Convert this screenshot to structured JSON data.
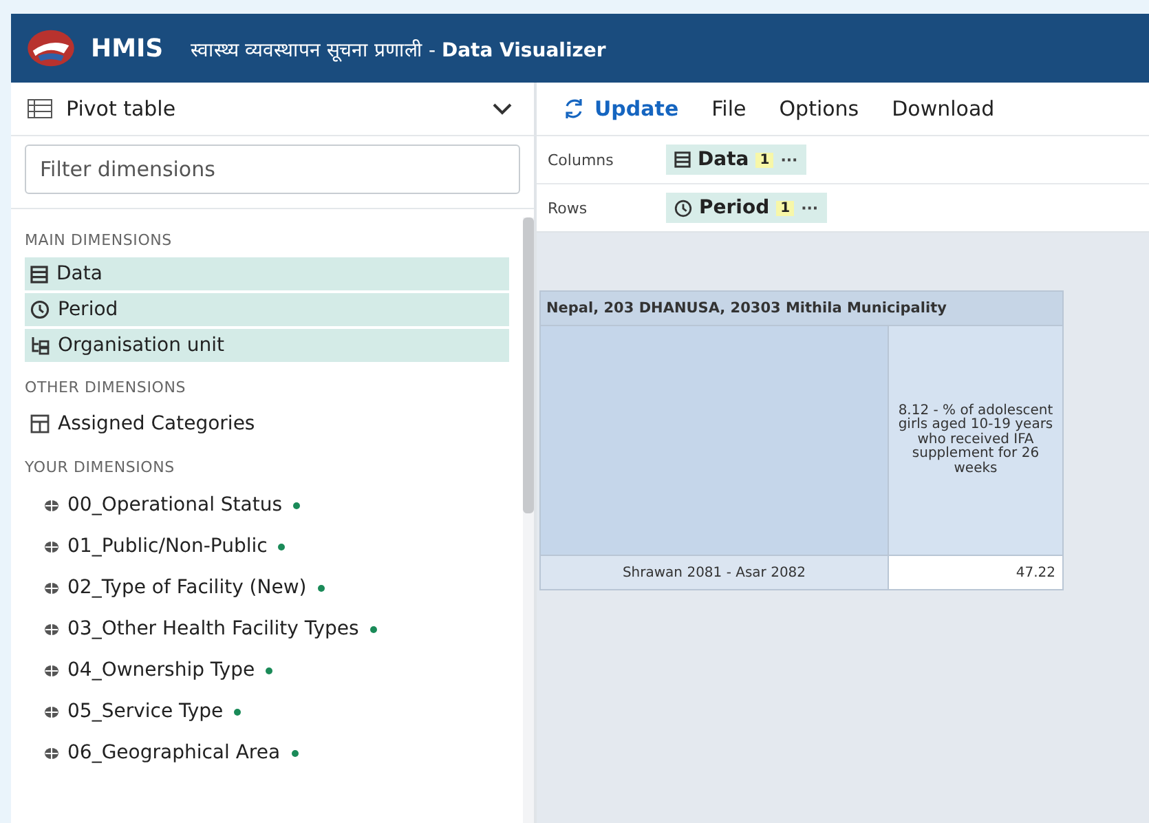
{
  "header": {
    "app_name": "HMIS",
    "subtitle": "स्वास्थ्य व्यवस्थापन सूचना प्रणाली - **Data Visualizer**"
  },
  "visualization_type": {
    "label": "Pivot table"
  },
  "menu": [
    {
      "label": "Update",
      "kind": "update"
    },
    {
      "label": "File",
      "kind": "plain"
    },
    {
      "label": "Options",
      "kind": "plain"
    },
    {
      "label": "Download",
      "kind": "plain"
    }
  ],
  "filter": {
    "placeholder": "Filter dimensions"
  },
  "sections": [
    {
      "heading": "MAIN DIMENSIONS",
      "items": [
        {
          "label": "Data",
          "kind": "data",
          "selected": true
        },
        {
          "label": "Period",
          "kind": "period",
          "selected": true
        },
        {
          "label": "Organisation unit",
          "kind": "orgunit",
          "selected": true
        }
      ]
    },
    {
      "heading": "OTHER DIMENSIONS",
      "items": [
        {
          "label": "Assigned Categories",
          "kind": "category",
          "selected": false
        }
      ]
    },
    {
      "heading": "YOUR DIMENSIONS",
      "items": [
        {
          "label": "00_Operational Status",
          "kind": "dimension",
          "selected": false
        },
        {
          "label": "01_Public/Non-Public",
          "kind": "dimension",
          "selected": false
        },
        {
          "label": "02_Type of Facility (New)",
          "kind": "dimension",
          "selected": false
        },
        {
          "label": "03_Other Health Facility Types",
          "kind": "dimension",
          "selected": false
        },
        {
          "label": "04_Ownership Type",
          "kind": "dimension",
          "selected": false
        },
        {
          "label": "05_Service Type",
          "kind": "dimension",
          "selected": false
        },
        {
          "label": "06_Geographical Area",
          "kind": "dimension",
          "selected": false
        }
      ]
    }
  ],
  "layout": [
    {
      "axis": "Columns",
      "chips": [
        {
          "label": "Data",
          "kind": "data",
          "count": "1",
          "more": "···"
        }
      ]
    },
    {
      "axis": "Rows",
      "chips": [
        {
          "label": "Period",
          "kind": "period",
          "count": "1",
          "more": "···"
        }
      ]
    }
  ],
  "table": {
    "title": "Nepal, 203 DHANUSA, 20303 Mithila Municipality",
    "column_header": "8.12 - % of adolescent girls aged 10-19 years who received IFA supplement for 26 weeks",
    "rows": [
      {
        "label": "Shrawan 2081 - Asar 2082",
        "value": "47.22"
      }
    ]
  }
}
